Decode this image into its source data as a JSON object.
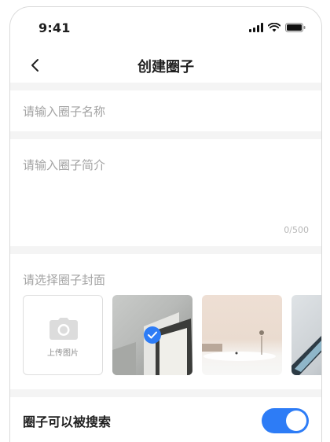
{
  "status": {
    "time": "9:41"
  },
  "nav": {
    "title": "创建圈子"
  },
  "form": {
    "name_placeholder": "请输入圈子名称",
    "intro_placeholder": "请输入圈子简介",
    "intro_counter": "0/500",
    "cover_label": "请选择圈子封面",
    "upload_label": "上传图片",
    "selected_cover_index": 1,
    "searchable_label": "圈子可以被搜索",
    "searchable_on": true
  },
  "colors": {
    "accent": "#2d7cf6",
    "placeholder": "#a3a3a3",
    "background": "#f4f4f4"
  },
  "icons": [
    "signal-icon",
    "wifi-icon",
    "battery-icon",
    "back-icon",
    "camera-icon",
    "check-icon"
  ]
}
